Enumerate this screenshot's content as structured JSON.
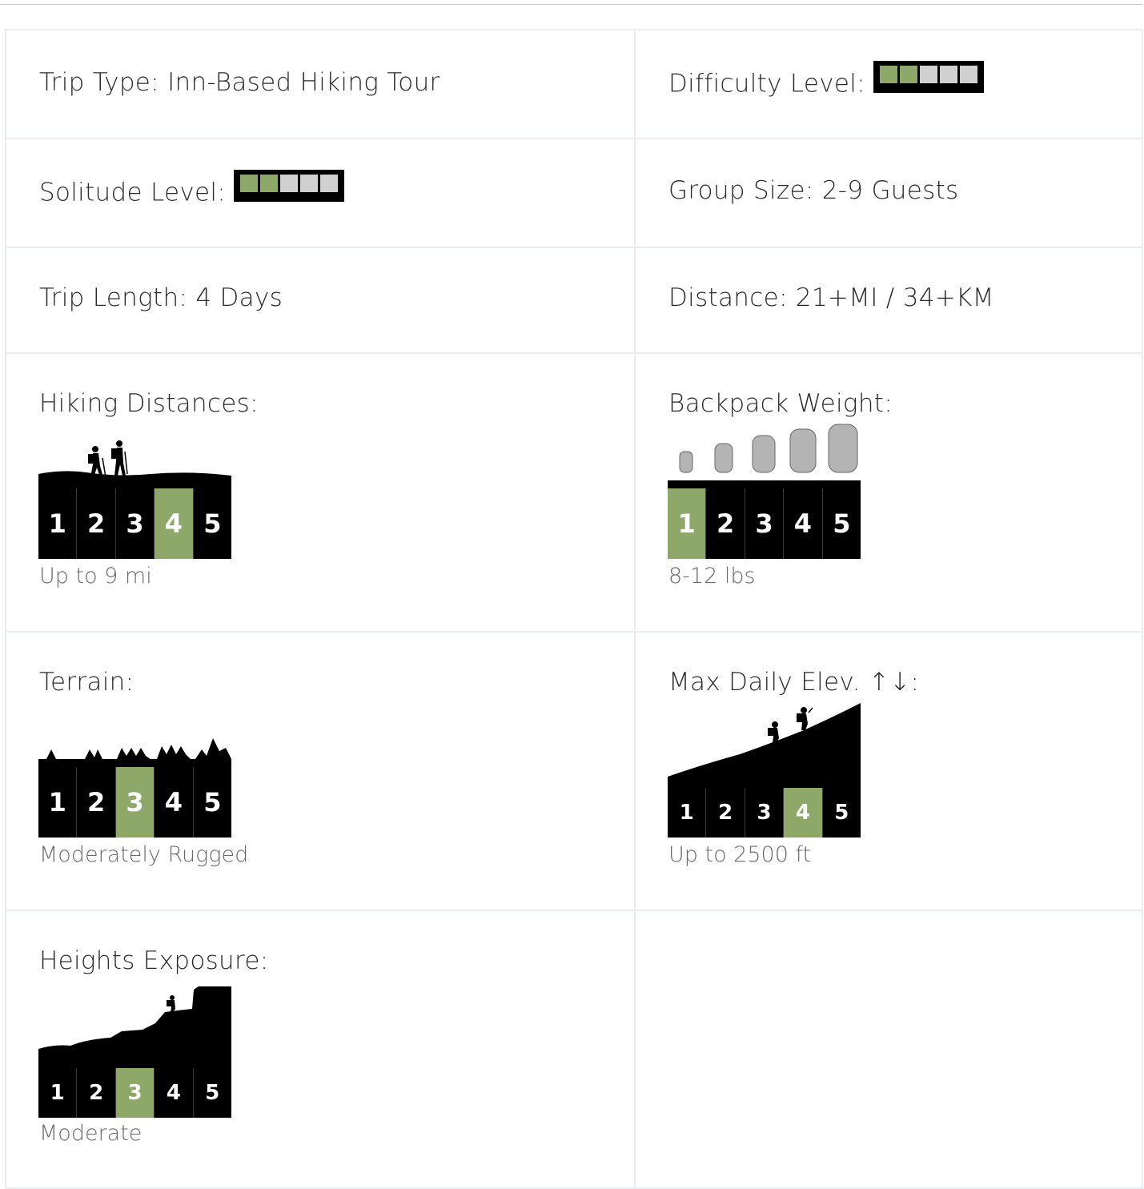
{
  "colors": {
    "active": "#8ea86a",
    "inactive": "#d0d0d0",
    "border": "#eaedef"
  },
  "rows": {
    "trip_type": {
      "label": "Trip Type: Inn-Based Hiking Tour"
    },
    "difficulty": {
      "label": "Difficulty Level:",
      "rating": 2,
      "max": 5
    },
    "solitude": {
      "label": "Solitude Level:",
      "rating": 2,
      "max": 5
    },
    "group_size": {
      "label": "Group Size: 2-9 Guests"
    },
    "trip_length": {
      "label": "Trip Length: 4 Days"
    },
    "distance": {
      "label": "Distance: 21+MI / 34+KM"
    },
    "hiking_distances": {
      "label": "Hiking Distances:",
      "scale": [
        "1",
        "2",
        "3",
        "4",
        "5"
      ],
      "active": 4,
      "caption": "Up to 9 mi",
      "icon": "hikers-icon"
    },
    "backpack_weight": {
      "label": "Backpack Weight:",
      "scale": [
        "1",
        "2",
        "3",
        "4",
        "5"
      ],
      "active": 1,
      "caption": "8-12 lbs",
      "icon": "backpack-icon"
    },
    "terrain": {
      "label": "Terrain:",
      "scale": [
        "1",
        "2",
        "3",
        "4",
        "5"
      ],
      "active": 3,
      "caption": "Moderately Rugged",
      "icon": "mountains-icon"
    },
    "max_daily_elev": {
      "label": "Max Daily Elev. ↑↓:",
      "scale": [
        "1",
        "2",
        "3",
        "4",
        "5"
      ],
      "active": 4,
      "caption": "Up to 2500 ft",
      "icon": "slope-hikers-icon"
    },
    "heights_exposure": {
      "label": "Heights Exposure:",
      "scale": [
        "1",
        "2",
        "3",
        "4",
        "5"
      ],
      "active": 3,
      "caption": "Moderate",
      "icon": "cliff-hiker-icon"
    }
  }
}
